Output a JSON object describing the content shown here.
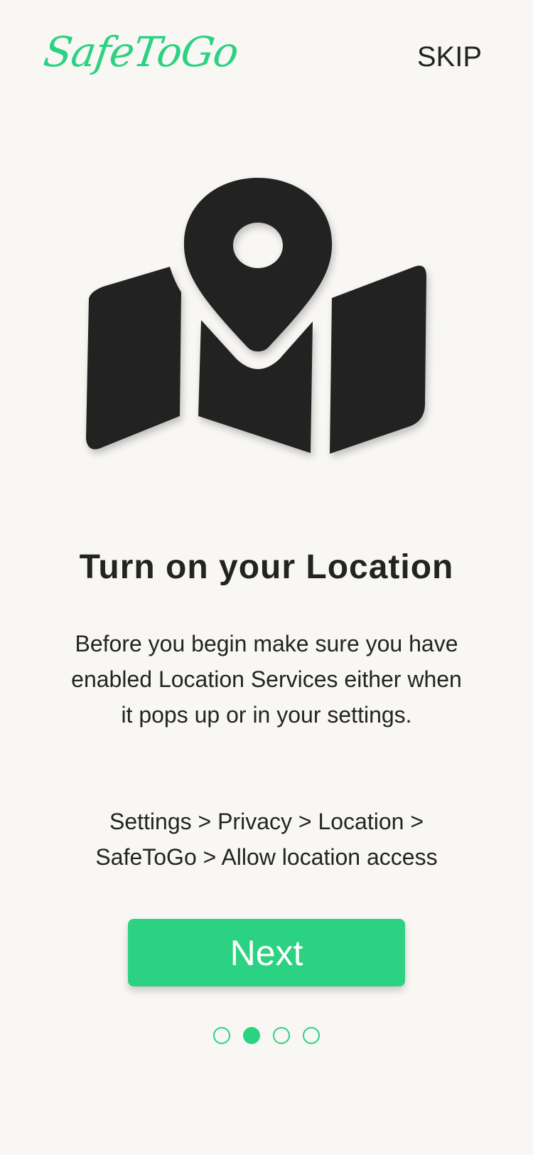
{
  "header": {
    "logo_text": "SafeToGo",
    "skip_label": "SKIP"
  },
  "illustration": {
    "icon": "map-pin-icon",
    "fill_color": "#222423"
  },
  "content": {
    "title": "Turn on your Location",
    "description": "Before you begin make sure you have enabled Location Services either when it pops up or in your settings.",
    "path_line_1": "Settings > Privacy > Location >",
    "path_line_2": "SafeToGo > Allow location access"
  },
  "actions": {
    "next_label": "Next"
  },
  "pagination": {
    "total": 4,
    "current": 2
  },
  "colors": {
    "accent": "#2bd281",
    "background": "#f8f7f4",
    "text": "#222423"
  }
}
